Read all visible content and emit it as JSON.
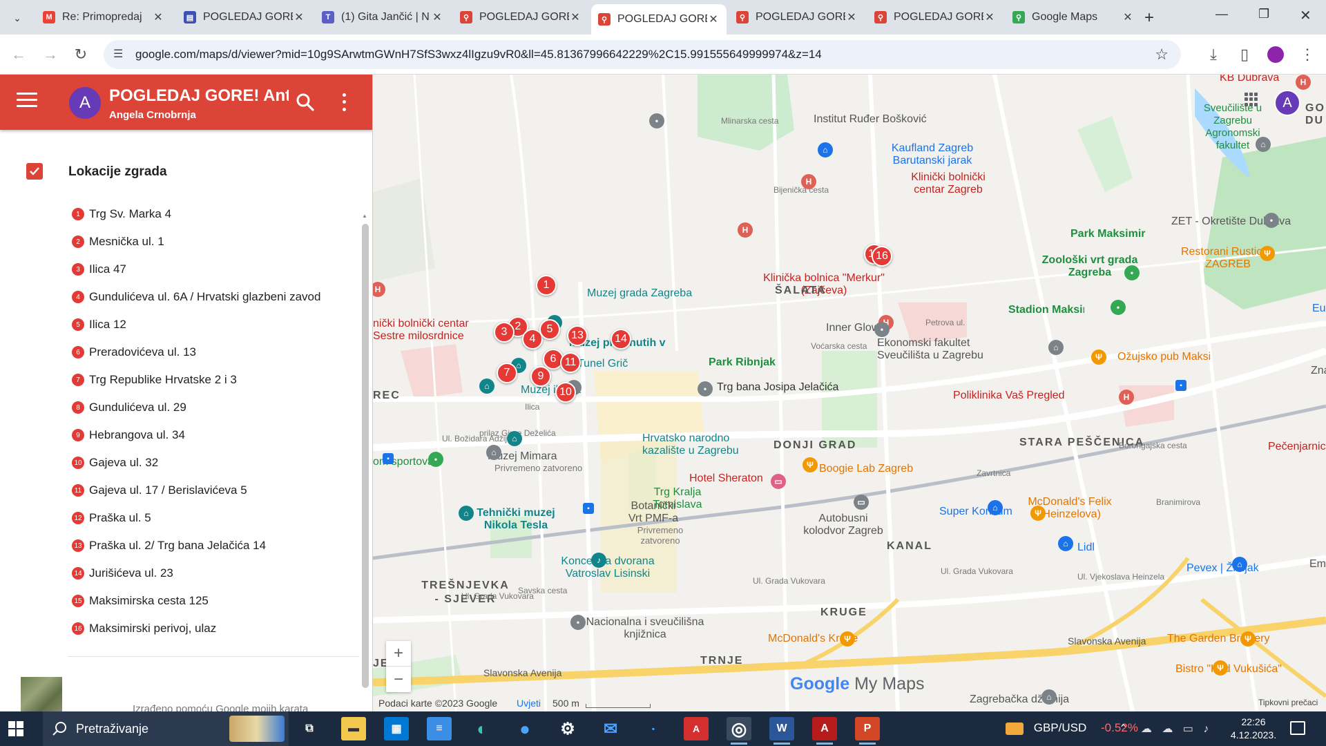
{
  "browser": {
    "tabs": [
      {
        "label": "Re: Primopredaj",
        "icon": "gmail-icon",
        "color": "#ea4335",
        "glyph": "M",
        "active": false
      },
      {
        "label": "POGLEDAJ GORE",
        "icon": "google-forms-icon",
        "color": "#3f51b5",
        "glyph": "▤",
        "active": false
      },
      {
        "label": "(1) Gita Jančić | N",
        "icon": "teams-icon",
        "color": "#5b5fc7",
        "glyph": "T",
        "active": false
      },
      {
        "label": "POGLEDAJ GORE",
        "icon": "my-maps-icon",
        "color": "#db4437",
        "glyph": "⚲",
        "active": false
      },
      {
        "label": "POGLEDAJ GORE",
        "icon": "my-maps-icon",
        "color": "#db4437",
        "glyph": "⚲",
        "active": true
      },
      {
        "label": "POGLEDAJ GORE",
        "icon": "my-maps-icon",
        "color": "#db4437",
        "glyph": "⚲",
        "active": false
      },
      {
        "label": "POGLEDAJ GORE",
        "icon": "my-maps-icon",
        "color": "#db4437",
        "glyph": "⚲",
        "active": false
      },
      {
        "label": "Google Maps",
        "icon": "google-maps-icon",
        "color": "#34a853",
        "glyph": "⚲",
        "active": false
      }
    ],
    "new_tab": "+",
    "window_controls": {
      "minimize": "—",
      "restore": "❐",
      "close": "✕"
    },
    "url": "google.com/maps/d/viewer?mid=10g9SArwtmGWnH7SfS3wxz4lIgzu9vR0&ll=45.81367996642229%2C15.991555649999974&z=14"
  },
  "panel": {
    "title": "POGLEDAJ GORE! Ant...",
    "owner": "Angela Crnobrnja",
    "avatar_letter": "A",
    "accent_color": "#db4437",
    "layer_title": "Lokacije zgrada",
    "layer_checked": true,
    "locations": [
      {
        "num": "1",
        "name": "Trg Sv. Marka 4"
      },
      {
        "num": "2",
        "name": "Mesnička ul. 1"
      },
      {
        "num": "3",
        "name": "Ilica 47"
      },
      {
        "num": "4",
        "name": "Gundulićeva ul. 6A / Hrvatski glazbeni zavod"
      },
      {
        "num": "5",
        "name": "Ilica 12"
      },
      {
        "num": "6",
        "name": "Preradovićeva ul. 13"
      },
      {
        "num": "7",
        "name": "Trg Republike Hrvatske 2 i 3"
      },
      {
        "num": "8",
        "name": "Gundulićeva ul. 29"
      },
      {
        "num": "9",
        "name": "Hebrangova ul. 34"
      },
      {
        "num": "10",
        "name": "Gajeva ul. 32"
      },
      {
        "num": "11",
        "name": "Gajeva ul. 17 / Berislavićeva 5"
      },
      {
        "num": "12",
        "name": "Praška ul. 5"
      },
      {
        "num": "13",
        "name": "Praška ul. 2/ Trg bana Jelačića 14"
      },
      {
        "num": "14",
        "name": "Jurišićeva ul. 23"
      },
      {
        "num": "15",
        "name": "Maksimirska cesta 125"
      },
      {
        "num": "16",
        "name": "Maksimirski perivoj, ulaz"
      }
    ],
    "footer_text": "Izrađeno pomoću Google mojih karata"
  },
  "map": {
    "pins": [
      "1",
      "2",
      "3",
      "4",
      "5",
      "6",
      "7",
      "9",
      "10",
      "11",
      "13",
      "14",
      "15",
      "16"
    ],
    "labels": {
      "irb": "Institut Ruđer Bošković",
      "kaufland": "Kaufland Zagreb Barutanski jarak",
      "kbc": "Klinički bolnički centar Zagreb",
      "svuciliste_agro": "Sveučilište u Zagrebu Agronomski fakultet",
      "kb_dubrava": "KB Dubrava",
      "park_maksimir": "Park Maksimir",
      "zet": "ZET - Okretište Dubrava",
      "zoo": "Zoološki vrt grada Zagreba",
      "restoran_rustica": "Restorani Rustica - ZAGREB",
      "merkur": "Klinička bolnica \"Merkur\" (Zajčeva)",
      "stadion": "Stadion Maksimir",
      "salata": "ŠALATA",
      "muzej_grada": "Muzej grada Zagreba",
      "inner_glow": "Inner Glow",
      "ekonomski": "Ekonomski fakultet Sveučilišta u Zagrebu",
      "ozujsko": "Ožujsko pub Maksi",
      "kbc_sestre": "nički bolnički centar Sestre milosrdnice",
      "muzej_prekinutih": "Muzej prekinutih veza",
      "tunel": "Tunel Grič",
      "park_ribnjak": "Park Ribnjak",
      "trg_bana": "Trg bana Josipa Jelačića",
      "poliklinika": "Poliklinika Vaš Pregled",
      "muzej_iluzija": "Muzej iluzija",
      "rec": "REC",
      "donji_grad": "DONJI GRAD",
      "stara_pescenica": "STARA PEŠČENICA",
      "hrv_narodno": "Hrvatsko narodno kazalište u Zagrebu",
      "sportova": "om sportova",
      "muzej_mimara": "Muzej Mimara",
      "privremeno1": "Privremeno zatvoreno",
      "hotel_sheraton": "Hotel Sheraton",
      "boogie": "Boogie Lab Zagreb",
      "pecenjarnica": "Pečenjarnica",
      "trg_kralja": "Trg Kralja Tomislava",
      "botanicki": "Botanički Vrt PMF-a",
      "privremeno2": "Privremeno zatvoreno",
      "tehnicki": "Tehnički muzej Nikola Tesla",
      "autobusni": "Autobusni kolodvor Zagreb",
      "super_konzum": "Super Konzum",
      "mcd_felix": "McDonald's Felix (Heinzelova)",
      "kanal": "KANAL",
      "lidl": "Lidl",
      "koncertna": "Koncertna dvorana Vatroslav Lisinski",
      "pevex": "Pevex | Žitnjak",
      "trnjevka": "TREŠNJEVKA - SJEVER",
      "kruge": "KRUGE",
      "nacionalna": "Nacionalna i sveučilišna knjižnica",
      "mcd_kruge": "McDonald's Kruge",
      "garden": "The Garden Brewery",
      "trnje": "TRNJE",
      "bistro": "Bistro \"Kod Vukušića\"",
      "dzamija": "Zagrebačka džamija",
      "je": "JE",
      "znu": "Zna",
      "emi": "Emi",
      "eu": "Eu",
      "go_du": "GO DU",
      "st_slavonska1": "Slavonska Avenija",
      "st_slavonska2": "Slavonska Avenija",
      "st_vukovara1": "Ul. Grada Vukovara",
      "st_vukovara2": "Ul. Grada Vukovara",
      "st_vukovara3": "Ul. Grada Vukovara",
      "st_bozidara": "Ul. Božidara Adžije",
      "st_vocarska": "Voćarska cesta",
      "st_petrova": "Petrova ul.",
      "st_ilica": "Ilica",
      "st_bijenicka": "Bijenička cesta",
      "st_mlinarska": "Mlinarska cesta",
      "st_branimirova": "Branimirova",
      "st_borongajska": "Borongajska cesta",
      "st_zavrtnica": "Zavrtnica",
      "st_heinzelova": "Ul. Vjekoslava Heinzela",
      "st_savska": "Savska cesta",
      "st_prilaz": "prilaz Gjure Deželića"
    },
    "zoom_in": "+",
    "zoom_out": "−",
    "brand_google": "Google",
    "brand_mymaps": "My Maps",
    "footer_data": "Podaci karte ©2023 Google",
    "footer_terms": "Uvjeti",
    "footer_scale": "500 m",
    "footer_shortcuts": "Tipkovni prečaci",
    "avatar_letter": "A"
  },
  "taskbar": {
    "search_placeholder": "Pretraživanje",
    "currency_pair": "GBP/USD",
    "currency_change": "-0.52%",
    "time": "22:26",
    "date": "4.12.2023."
  }
}
